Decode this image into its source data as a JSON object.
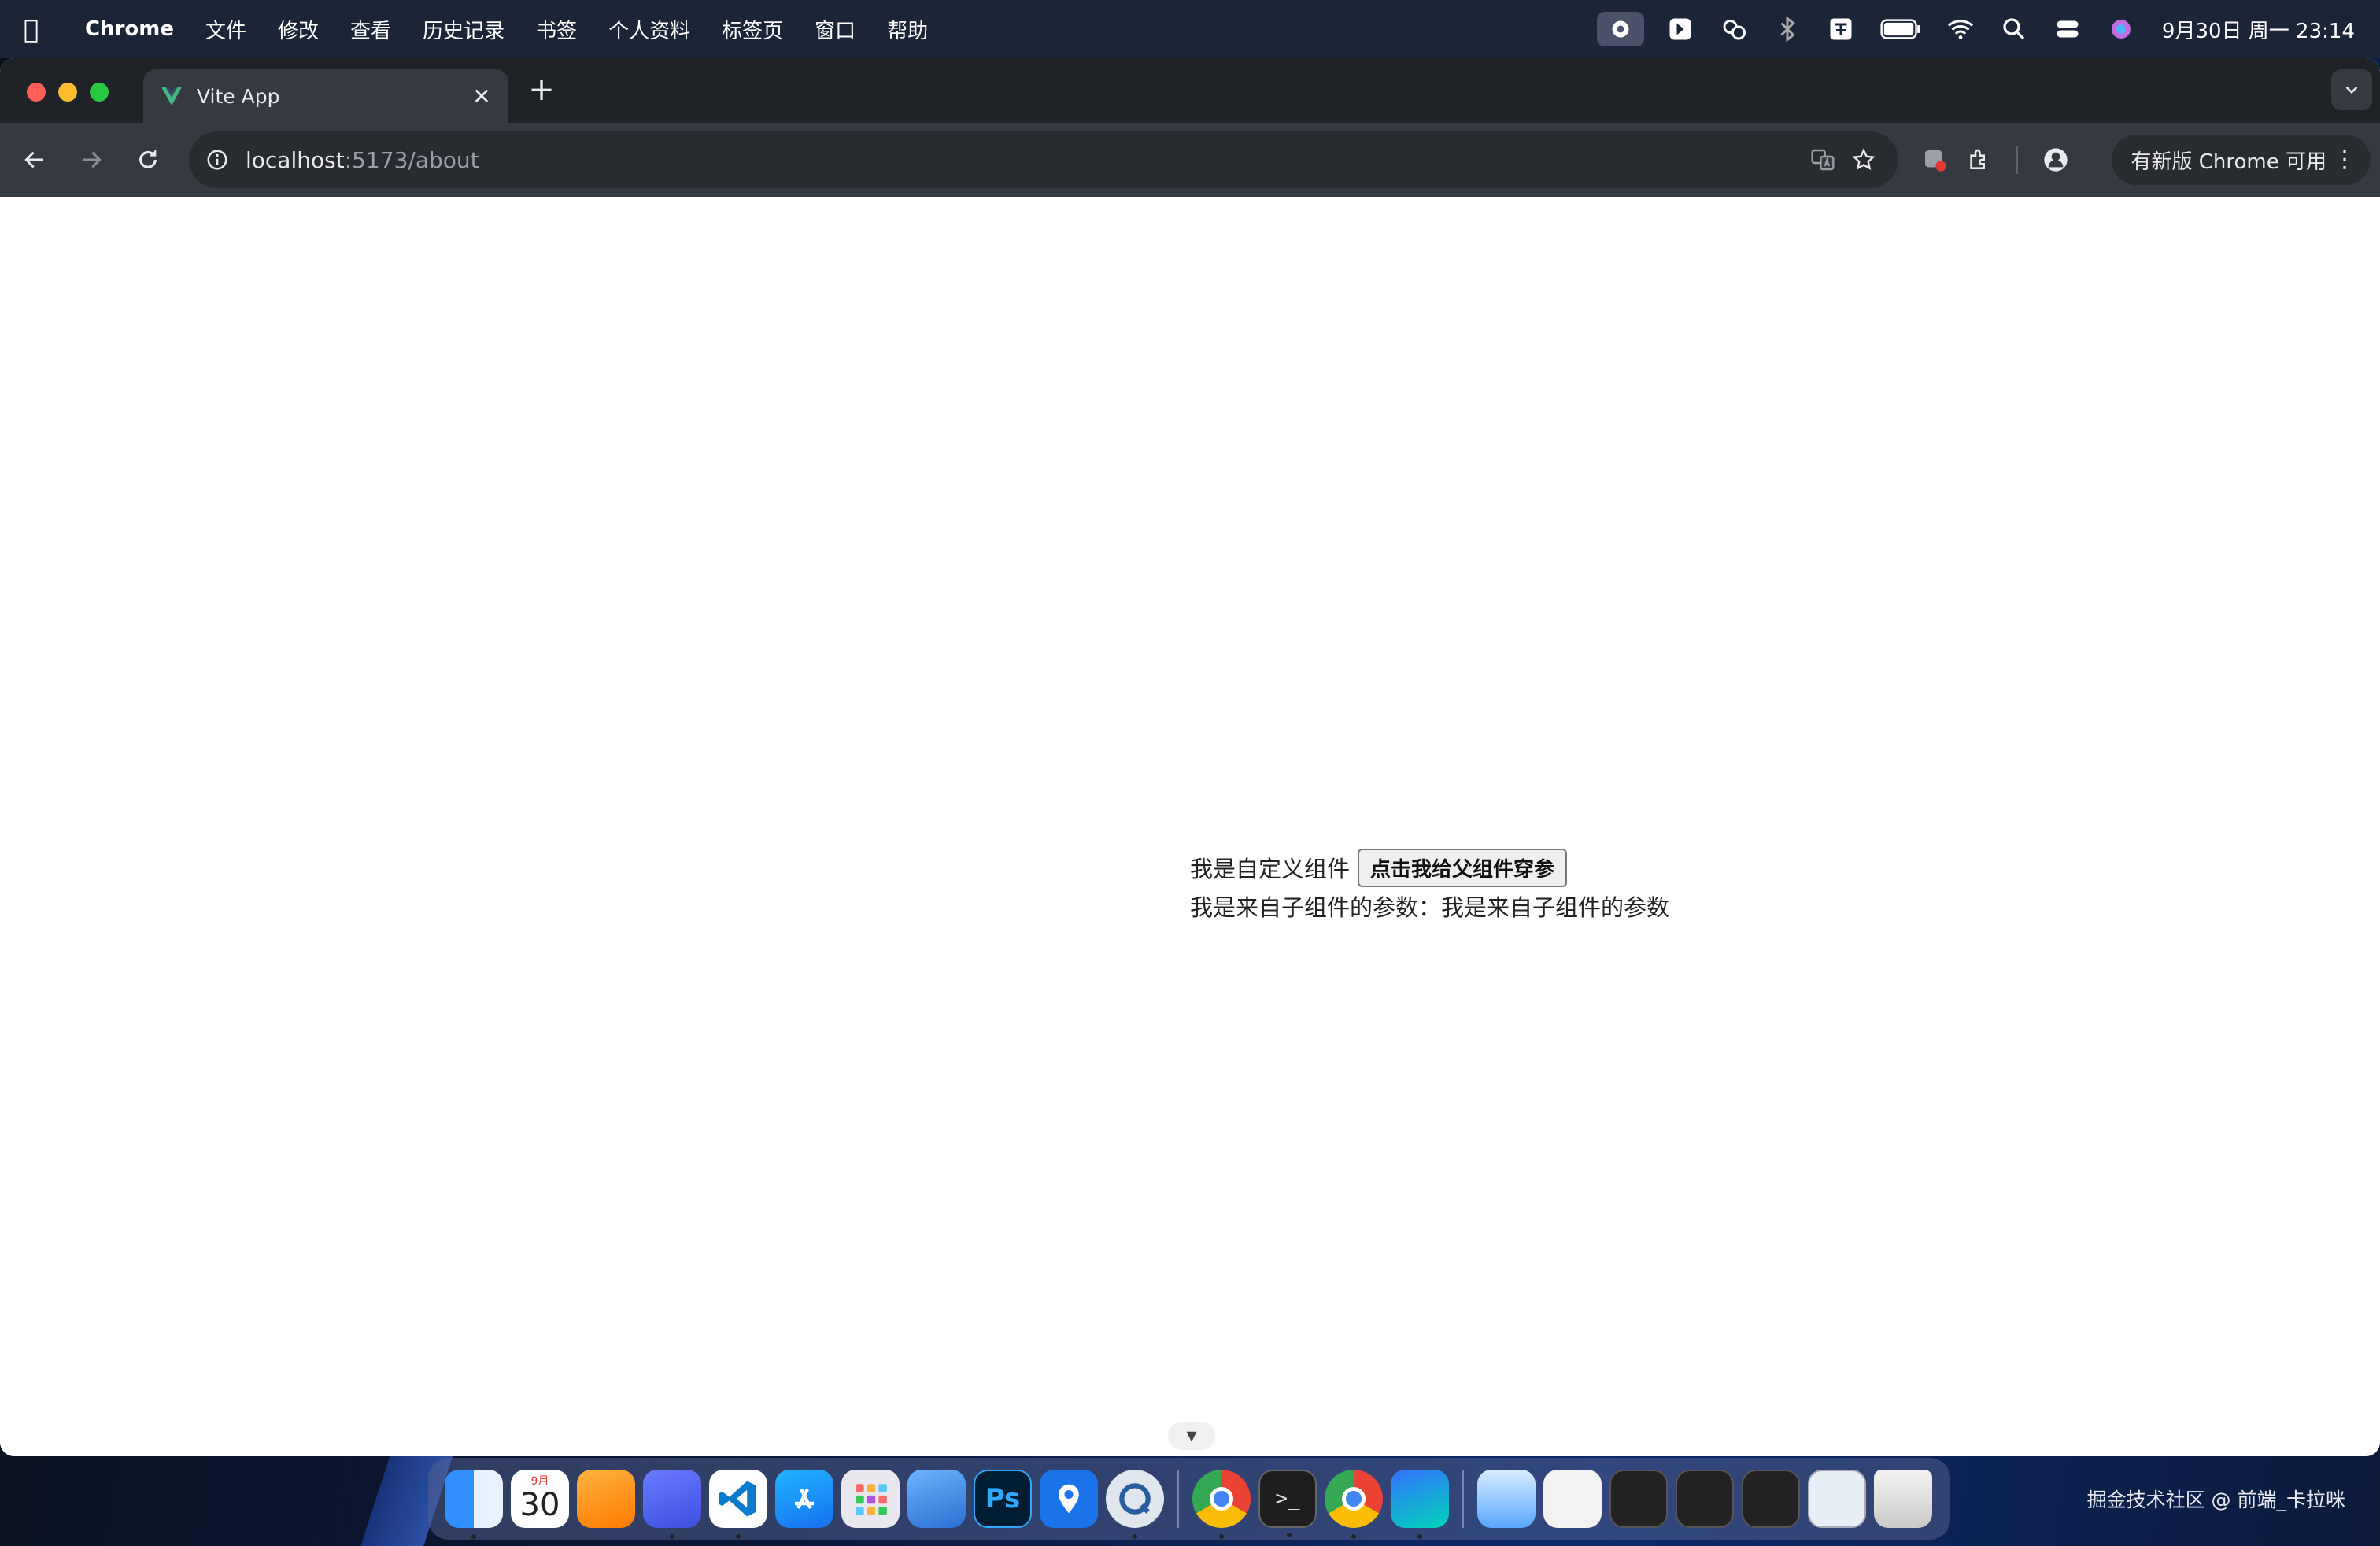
{
  "menubar": {
    "app_name": "Chrome",
    "items": [
      "文件",
      "修改",
      "查看",
      "历史记录",
      "书签",
      "个人资料",
      "标签页",
      "窗口",
      "帮助"
    ],
    "status_icons": [
      "screen-record-icon",
      "app-icon",
      "weather-icon",
      "bluetooth-icon",
      "input-method-icon",
      "battery-icon",
      "wifi-icon",
      "spotlight-search-icon",
      "control-center-icon",
      "siri-icon"
    ],
    "clock": "9月30日 周一  23:14"
  },
  "browser": {
    "tab_title": "Vite App",
    "url_host": "localhost",
    "url_path": ":5173/about",
    "update_label": "有新版 Chrome 可用"
  },
  "page": {
    "component_label": "我是自定义组件",
    "button_label": "点击我给父组件穿参",
    "param_line": "我是来自子组件的参数：我是来自子组件的参数"
  },
  "dock": {
    "calendar_month": "9月",
    "calendar_day": "30",
    "apps": [
      "finder-icon",
      "calendar-icon",
      "pages-icon",
      "pen-app-icon",
      "vscode-icon",
      "app-store-icon",
      "launchpad-icon",
      "screen-share-icon",
      "photoshop-icon",
      "maps-pin-icon",
      "quicktime-icon",
      "chrome-icon",
      "terminal-icon",
      "chrome-icon",
      "feishu-icon",
      "drive-icon",
      "preview-icon",
      "window-thumb-icon",
      "window-thumb-icon",
      "window-thumb-icon",
      "window-thumb-icon",
      "trash-icon"
    ]
  },
  "watermark": "掘金技术社区 @ 前端_卡拉咪",
  "colors": {
    "tab_strip": "#1f2328",
    "toolbar": "#353a40",
    "omnibox": "#282c31",
    "traffic_red": "#ff5f57",
    "traffic_yellow": "#febc2e",
    "traffic_green": "#28c840",
    "vue_green": "#41b883"
  }
}
